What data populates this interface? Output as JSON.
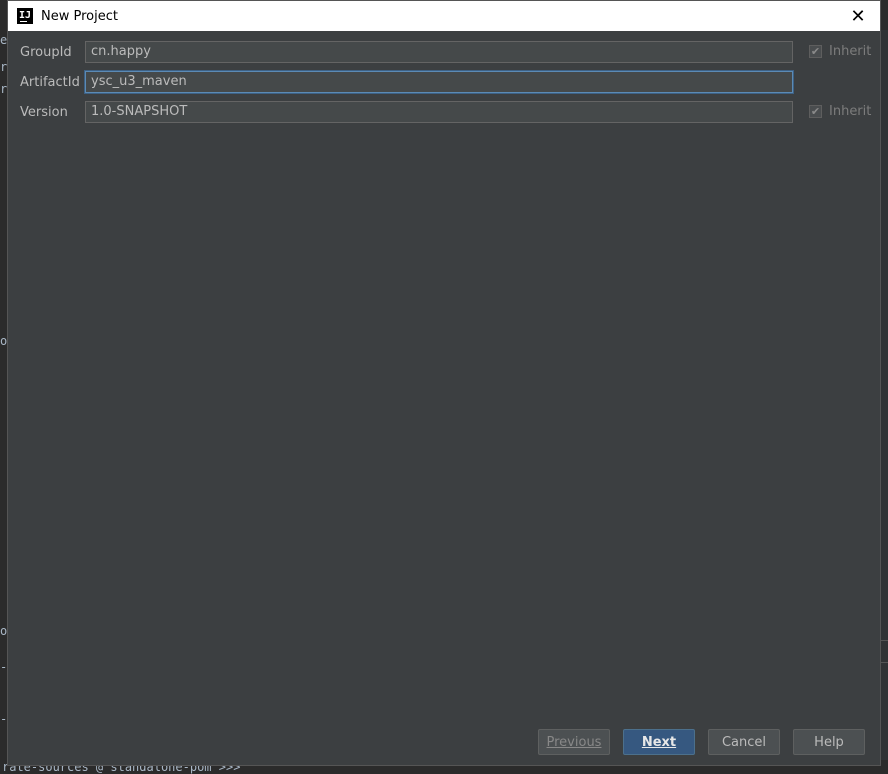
{
  "window": {
    "title": "New Project"
  },
  "fields": [
    {
      "label": "GroupId",
      "value": "cn.happy",
      "inherit": true,
      "inherit_label": "Inherit"
    },
    {
      "label": "ArtifactId",
      "value": "ysc_u3_maven"
    },
    {
      "label": "Version",
      "value": "1.0-SNAPSHOT",
      "inherit": true,
      "inherit_label": "Inherit"
    }
  ],
  "buttons": {
    "previous": {
      "label": "Previous",
      "enabled": false
    },
    "next": {
      "label": "Next"
    },
    "cancel": {
      "label": "Cancel"
    },
    "help": {
      "label": "Help"
    }
  },
  "background": {
    "bottom_text": "rate-sources @ standalone-pom >>>",
    "left_fragments": [
      "e",
      "rn",
      "r",
      "o",
      "oj",
      "-",
      "-"
    ]
  },
  "colors": {
    "dialog_bg": "#3c3f41",
    "field_bg": "#45494a",
    "primary_button": "#365880",
    "focus_border": "#5b8ab5"
  }
}
